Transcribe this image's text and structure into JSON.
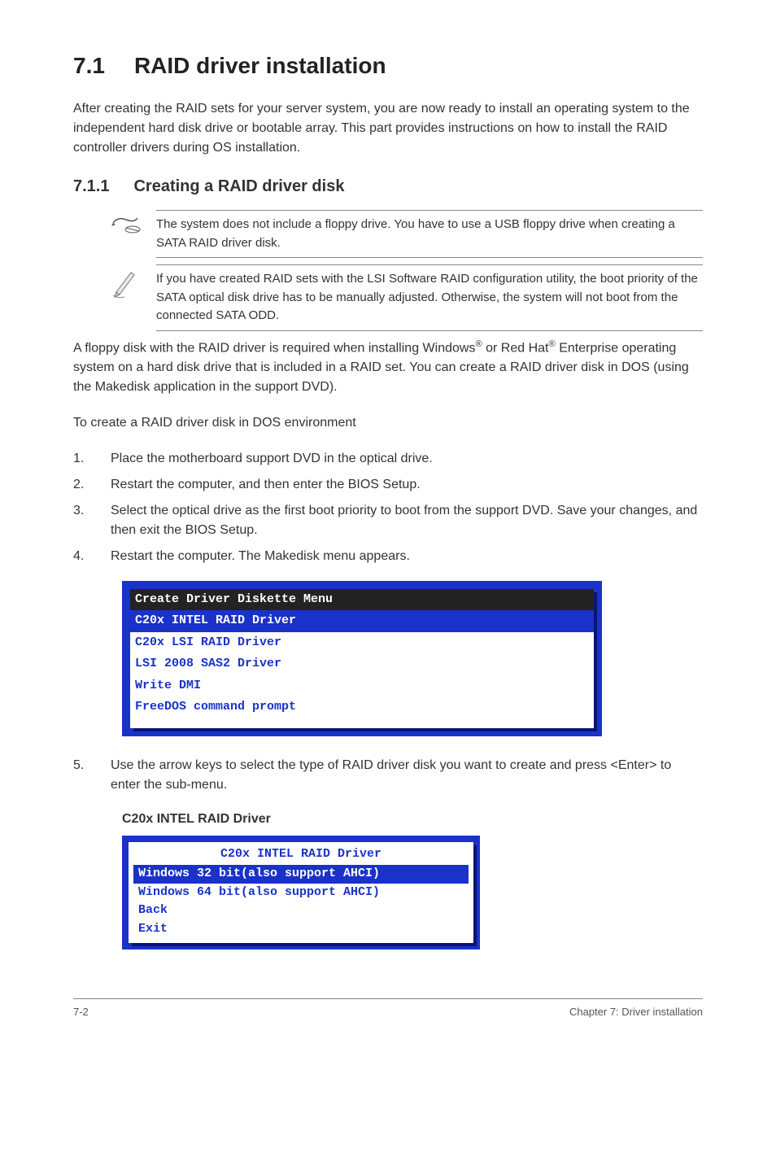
{
  "heading": {
    "number": "7.1",
    "title": "RAID driver installation"
  },
  "intro": "After creating the RAID sets for your server system, you are now ready to install an operating system to the independent hard disk drive or bootable array. This part provides instructions on how to install the RAID controller drivers during OS installation.",
  "subheading": {
    "number": "7.1.1",
    "title": "Creating a RAID driver disk"
  },
  "note1": "The system does not include a floppy drive. You have to use a USB floppy drive when creating a SATA RAID driver disk.",
  "note2": "If you have created RAID sets with the LSI Software RAID configuration utility, the boot priority of the SATA optical disk drive has to be manually adjusted. Otherwise, the system will not boot from the connected SATA ODD.",
  "para1_a": "A floppy disk with the RAID driver is required when installing Windows",
  "para1_b": " or Red Hat",
  "para1_c": " Enterprise operating system on a hard disk drive that is included in a RAID set. You can create a RAID driver disk in DOS (using the Makedisk application in the support DVD).",
  "reg": "®",
  "para2": "To create a RAID driver disk in DOS environment",
  "steps": [
    {
      "n": "1.",
      "t": "Place the motherboard support DVD in the optical drive."
    },
    {
      "n": "2.",
      "t": "Restart the computer, and then enter the BIOS Setup."
    },
    {
      "n": "3.",
      "t": "Select the optical drive as the first boot priority to boot from the support DVD. Save your changes, and then exit the BIOS Setup."
    },
    {
      "n": "4.",
      "t": "Restart the computer. The Makedisk menu appears."
    }
  ],
  "console1": {
    "title": "Create Driver Diskette Menu",
    "selected": "C20x INTEL RAID Driver",
    "items": [
      "C20x LSI RAID Driver",
      "LSI 2008 SAS2 Driver",
      "Write DMI",
      "FreeDOS command prompt"
    ]
  },
  "step5": {
    "n": "5.",
    "t": "Use the arrow keys to select the type of RAID driver disk you want to create and press <Enter> to enter the sub-menu."
  },
  "submenu_label": "C20x INTEL RAID Driver",
  "console2": {
    "title": "C20x INTEL RAID Driver",
    "selected": "Windows 32 bit(also support AHCI)",
    "items": [
      "Windows 64 bit(also support AHCI)",
      "Back",
      "Exit"
    ]
  },
  "footer": {
    "left": "7-2",
    "right": "Chapter 7: Driver installation"
  }
}
